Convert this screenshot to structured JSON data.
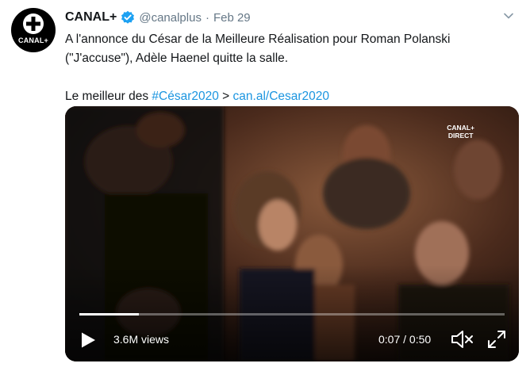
{
  "tweet": {
    "display_name": "CANAL+",
    "handle": "@canalplus",
    "separator": "·",
    "date": "Feb 29",
    "avatar_text": "CANAL+",
    "text_line1": "A l'annonce du César de la Meilleure Réalisation pour Roman Polanski",
    "text_line2": "(\"J'accuse\"), Adèle Haenel quitte la salle.",
    "text_line3_prefix": "Le meilleur des ",
    "hashtag": "#César2020",
    "arrow": " > ",
    "url": "can.al/Cesar2020"
  },
  "video": {
    "badge_line1": "CANAL+",
    "badge_line2": "DIRECT",
    "views": "3.6M views",
    "time": "0:07 / 0:50",
    "progress": 0.14
  },
  "icons": {
    "verified": "verified-badge-icon",
    "caret": "chevron-down-icon",
    "play": "play-icon",
    "volume": "volume-muted-icon",
    "fullscreen": "fullscreen-icon"
  },
  "colors": {
    "link": "#1b95e0",
    "verified": "#1da1f2",
    "secondary_text": "#657786"
  }
}
